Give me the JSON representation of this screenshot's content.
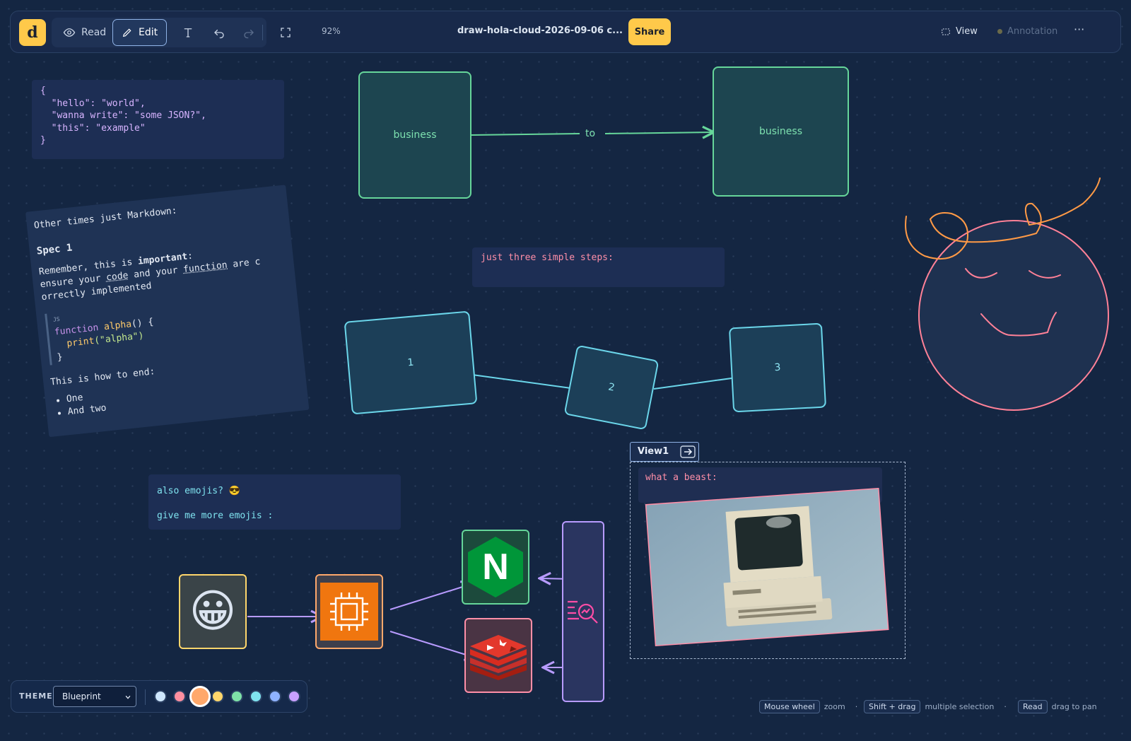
{
  "toolbar": {
    "logo": "d",
    "read_label": "Read",
    "edit_label": "Edit",
    "zoom": "92%",
    "filename": "draw-hola-cloud-2026-09-06 c...",
    "share_label": "Share",
    "view_label": "View",
    "annotation_label": "Annotation",
    "more_label": "···"
  },
  "canvas": {
    "json_lines": [
      "{",
      "  \"hello\": \"world\",",
      "  \"wanna write\": \"some JSON?\",",
      "  \"this\": \"example\"",
      "}"
    ],
    "markdown": {
      "intro": "Other times just Markdown:",
      "heading": "Spec 1",
      "p1_a": "Remember, this is ",
      "p1_bold": "important",
      "p1_b": ":",
      "p2_a": "ensure your ",
      "p2_code": "code",
      "p2_b": " and your ",
      "p2_fn": "function",
      "p2_c": " are c",
      "p3": "orrectly implemented",
      "code_lang": "JS",
      "code_kw": "function",
      "code_fn": "alpha",
      "code_open": "() {",
      "code_print": "print",
      "code_str": "(\"alpha\")",
      "code_close": "}",
      "ending": "This is how to end:",
      "list": [
        "One",
        "And two"
      ]
    },
    "business_left": "business",
    "business_right": "business",
    "arrow_label": "to",
    "steps_text": "just three simple steps:",
    "step1": "1",
    "step2": "2",
    "step3": "3",
    "emoji_line1": "also emojis? 😎",
    "emoji_line2": "give me more emojis :",
    "view_tab": "View1",
    "beast_text": "what a beast:",
    "emoji_tile": "😀",
    "nginx_letter": "N"
  },
  "theme": {
    "label": "THEME",
    "selected": "Blueprint",
    "swatches": [
      "#cfe8ff",
      "#ff8fa0",
      "#ffa86b",
      "#ffd66b",
      "#7ee2a8",
      "#7fe3ef",
      "#8fb2ff",
      "#c9a0ff"
    ]
  },
  "hints": {
    "k1": "Mouse wheel",
    "t1": "zoom",
    "k2": "Shift + drag",
    "t2": "multiple selection",
    "k3": "Read",
    "t3": "drag to pan"
  },
  "colors": {
    "background": "#142642",
    "accent": "#ffc94a",
    "green": "#66d69a",
    "cyan": "#6bd6ea",
    "pink": "#ff8fa8",
    "purple": "#c9a0ff"
  }
}
